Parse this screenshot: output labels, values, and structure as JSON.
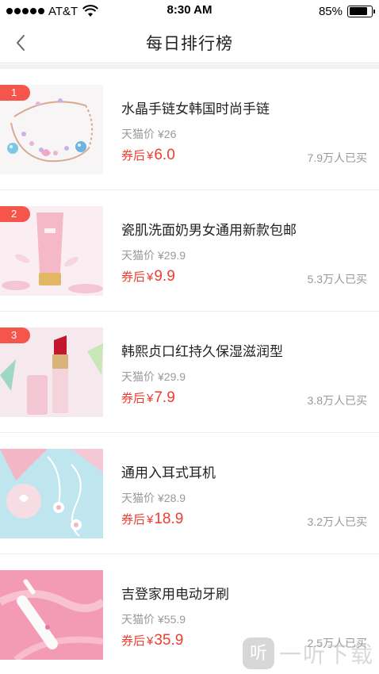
{
  "status_bar": {
    "carrier": "AT&T",
    "time": "8:30 AM",
    "battery_percent": "85%",
    "battery_level": 0.85
  },
  "nav": {
    "title": "每日排行榜",
    "back_icon": "chevron-left-icon"
  },
  "colors": {
    "accent_red": "#f03c2f",
    "badge_red": "#f5554a",
    "muted_text": "#999999"
  },
  "products": [
    {
      "rank": "1",
      "title": "水晶手链女韩国时尚手链",
      "orig_label": "天猫价",
      "orig_currency": "¥",
      "orig_price": "26",
      "coupon_label": "券后",
      "coupon_currency": "¥",
      "coupon_price": "6.0",
      "sold": "7.9万人已买",
      "image": "bracelet"
    },
    {
      "rank": "2",
      "title": "瓷肌洗面奶男女通用新款包邮",
      "orig_label": "天猫价",
      "orig_currency": "¥",
      "orig_price": "29.9",
      "coupon_label": "券后",
      "coupon_currency": "¥",
      "coupon_price": "9.9",
      "sold": "5.3万人已买",
      "image": "cleanser-tube"
    },
    {
      "rank": "3",
      "title": "韩熙贞口红持久保湿滋润型",
      "orig_label": "天猫价",
      "orig_currency": "¥",
      "orig_price": "29.9",
      "coupon_label": "券后",
      "coupon_currency": "¥",
      "coupon_price": "7.9",
      "sold": "3.8万人已买",
      "image": "lipstick"
    },
    {
      "rank": "",
      "title": "通用入耳式耳机",
      "orig_label": "天猫价",
      "orig_currency": "¥",
      "orig_price": "28.9",
      "coupon_label": "券后",
      "coupon_currency": "¥",
      "coupon_price": "18.9",
      "sold": "3.2万人已买",
      "image": "earphones"
    },
    {
      "rank": "",
      "title": "吉登家用电动牙刷",
      "orig_label": "天猫价",
      "orig_currency": "¥",
      "orig_price": "55.9",
      "coupon_label": "券后",
      "coupon_currency": "¥",
      "coupon_price": "35.9",
      "sold": "2.5万人已买",
      "image": "toothbrush"
    }
  ],
  "watermark": {
    "logo_char": "听",
    "text": "一听下载"
  }
}
